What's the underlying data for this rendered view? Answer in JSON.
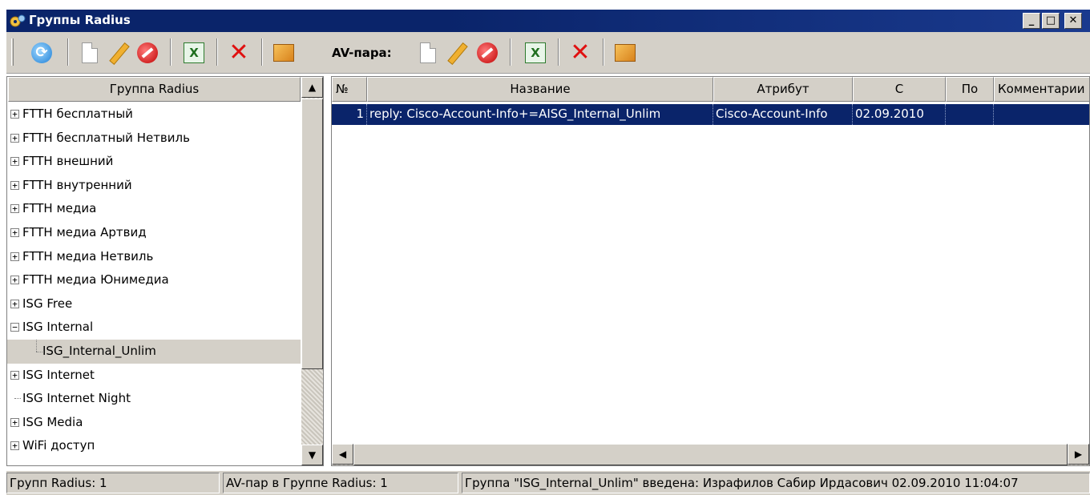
{
  "window": {
    "title": "Группы Radius",
    "minimize_label": "_",
    "maximize_label": "□",
    "close_label": "✕"
  },
  "toolbar": {
    "refresh_glyph": "⟳",
    "excel_glyph": "X",
    "delete_glyph": "✕",
    "av_label": "AV-пара:"
  },
  "left_panel": {
    "header": "Группа Radius",
    "items": [
      {
        "label": "FTTH бесплатный",
        "expander": "+"
      },
      {
        "label": "FTTH бесплатный Нетвиль",
        "expander": "+"
      },
      {
        "label": "FTTH внешний",
        "expander": "+"
      },
      {
        "label": "FTTH внутренний",
        "expander": "+"
      },
      {
        "label": "FTTH медиа",
        "expander": "+"
      },
      {
        "label": "FTTH медиа Артвид",
        "expander": "+"
      },
      {
        "label": "FTTH медиа Нетвиль",
        "expander": "+"
      },
      {
        "label": "FTTH медиа Юнимедиа",
        "expander": "+"
      },
      {
        "label": "ISG Free",
        "expander": "+"
      },
      {
        "label": "ISG Internal",
        "expander": "−"
      },
      {
        "label": "ISG_Internal_Unlim",
        "expander": ""
      },
      {
        "label": "ISG Internet",
        "expander": "+"
      },
      {
        "label": "ISG Internet Night",
        "expander": ""
      },
      {
        "label": "ISG Media",
        "expander": "+"
      },
      {
        "label": "WiFi доступ",
        "expander": "+"
      }
    ],
    "scroll_up": "▲",
    "scroll_down": "▼"
  },
  "grid": {
    "columns": [
      "№",
      "Название",
      "Атрибут",
      "С",
      "По",
      "Комментарии"
    ],
    "rows": [
      {
        "num": "1",
        "name": "reply: Cisco-Account-Info+=AISG_Internal_Unlim",
        "attribute": "Cisco-Account-Info",
        "from": "02.09.2010",
        "to": "",
        "comment": ""
      }
    ],
    "scroll_left": "◀",
    "scroll_right": "▶"
  },
  "status": {
    "groups": "Групп Radius: 1",
    "av_pairs": "AV-пар в Группе Radius: 1",
    "info": "Группа \"ISG_Internal_Unlim\" введена: Израфилов Сабир Ирдасович 02.09.2010 11:04:07"
  }
}
